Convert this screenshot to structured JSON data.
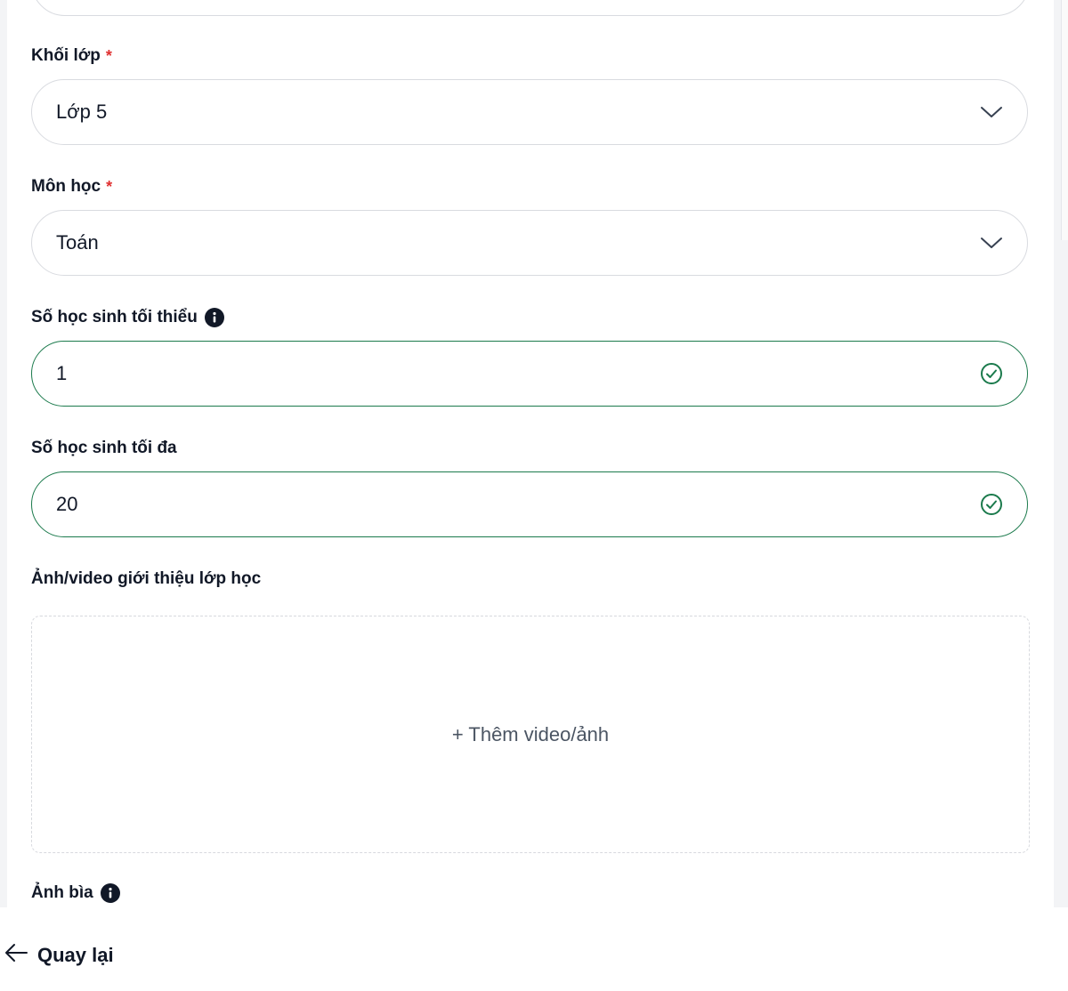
{
  "form": {
    "grade": {
      "label": "Khối lớp",
      "required_mark": "*",
      "value": "Lớp 5"
    },
    "subject": {
      "label": "Môn học",
      "required_mark": "*",
      "value": "Toán"
    },
    "min_students": {
      "label": "Số học sinh tối thiểu",
      "value": "1"
    },
    "max_students": {
      "label": "Số học sinh tối đa",
      "value": "20"
    },
    "media": {
      "label": "Ảnh/video giới thiệu lớp học",
      "add_label": "+ Thêm video/ảnh"
    },
    "cover": {
      "label": "Ảnh bìa"
    }
  },
  "footer": {
    "back_label": "Quay lại"
  },
  "colors": {
    "valid_border": "#1b7a4c",
    "required": "#e03131",
    "info_icon": "#111827"
  },
  "icons": {
    "dropdown": "chevron-down-icon",
    "valid": "check-circle-icon",
    "info": "info-icon",
    "back": "arrow-left-icon"
  }
}
